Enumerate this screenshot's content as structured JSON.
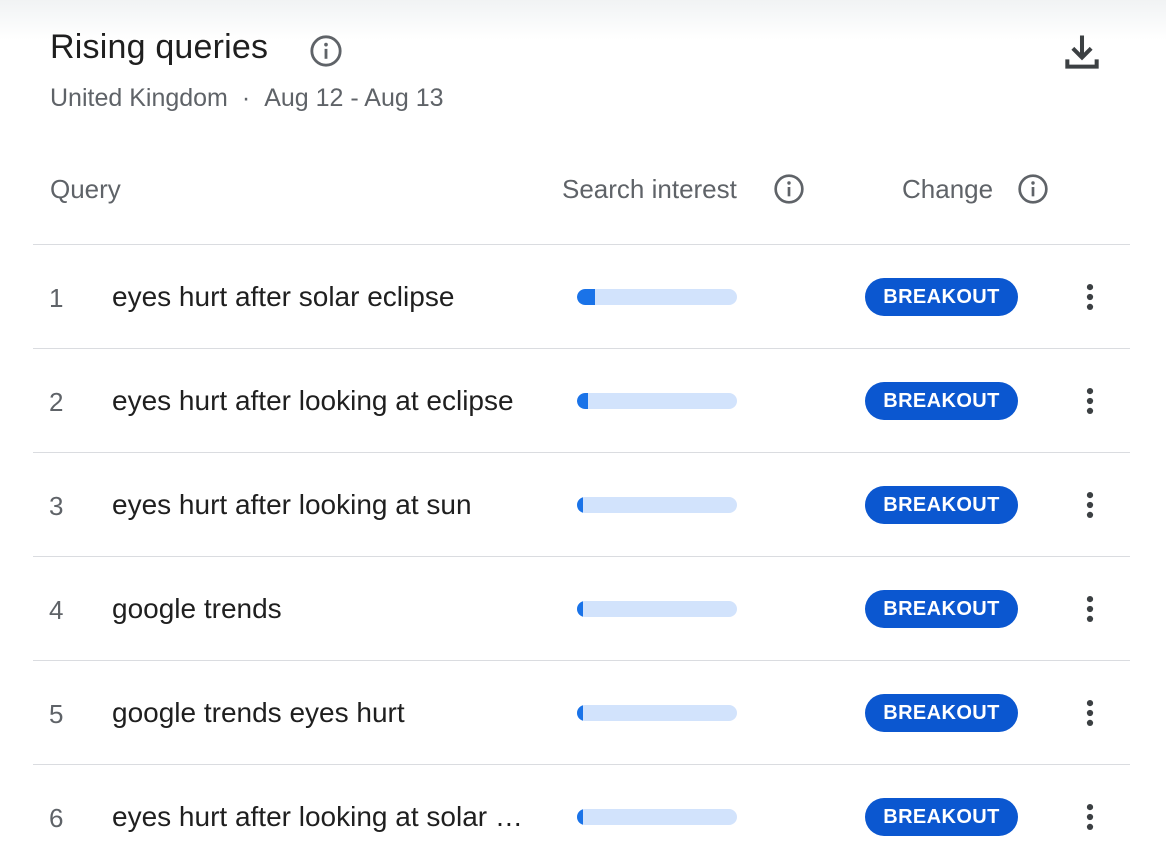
{
  "panel": {
    "title": "Rising queries",
    "region": "United Kingdom",
    "separator": "·",
    "date_range": "Aug 12 - Aug 13"
  },
  "columns": {
    "query": "Query",
    "search_interest": "Search interest",
    "change": "Change"
  },
  "icons": {
    "title_info": "info-icon",
    "download": "download-icon",
    "more": "more-vert-icon"
  },
  "colors": {
    "accent": "#0b57d0",
    "bar_fill": "#1a73e8",
    "bar_track": "#d2e3fc"
  },
  "rows": [
    {
      "rank": "1",
      "query": "eyes hurt after solar eclipse",
      "interest_fraction": 0.11,
      "change": "BREAKOUT"
    },
    {
      "rank": "2",
      "query": "eyes hurt after looking at eclipse",
      "interest_fraction": 0.07,
      "change": "BREAKOUT"
    },
    {
      "rank": "3",
      "query": "eyes hurt after looking at sun",
      "interest_fraction": 0.04,
      "change": "BREAKOUT"
    },
    {
      "rank": "4",
      "query": "google trends",
      "interest_fraction": 0.04,
      "change": "BREAKOUT"
    },
    {
      "rank": "5",
      "query": "google trends eyes hurt",
      "interest_fraction": 0.04,
      "change": "BREAKOUT"
    },
    {
      "rank": "6",
      "query": "eyes hurt after looking at solar eclipse",
      "interest_fraction": 0.04,
      "change": "BREAKOUT"
    }
  ]
}
